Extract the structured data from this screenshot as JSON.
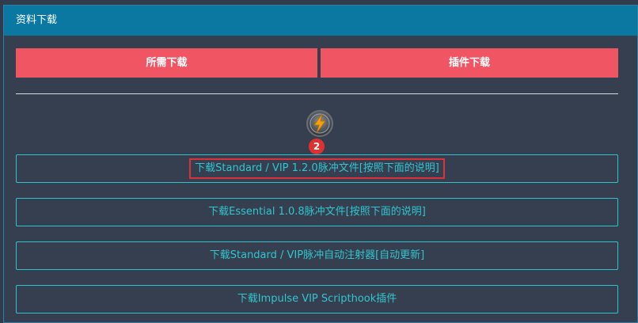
{
  "panel": {
    "title": "资料下载"
  },
  "top_buttons": {
    "left_label": "所需下载",
    "right_label": "插件下载"
  },
  "badge": {
    "count": "2"
  },
  "colors": {
    "header": "#0b78a1",
    "accent_red": "#f05564",
    "link_cyan": "#31c6d0",
    "highlight_box": "#d9343b"
  },
  "icons": {
    "logo": "lightning-logo-icon"
  },
  "downloads": [
    {
      "label": "下载Standard / VIP 1.2.0脉冲文件[按照下面的说明]",
      "highlighted": true
    },
    {
      "label": "下载Essential 1.0.8脉冲文件[按照下面的说明]",
      "highlighted": false
    },
    {
      "label": "下载Standard / VIP脉冲自动注射器[自动更新]",
      "highlighted": false
    },
    {
      "label": "下载Impulse VIP Scripthook插件",
      "highlighted": false
    }
  ]
}
